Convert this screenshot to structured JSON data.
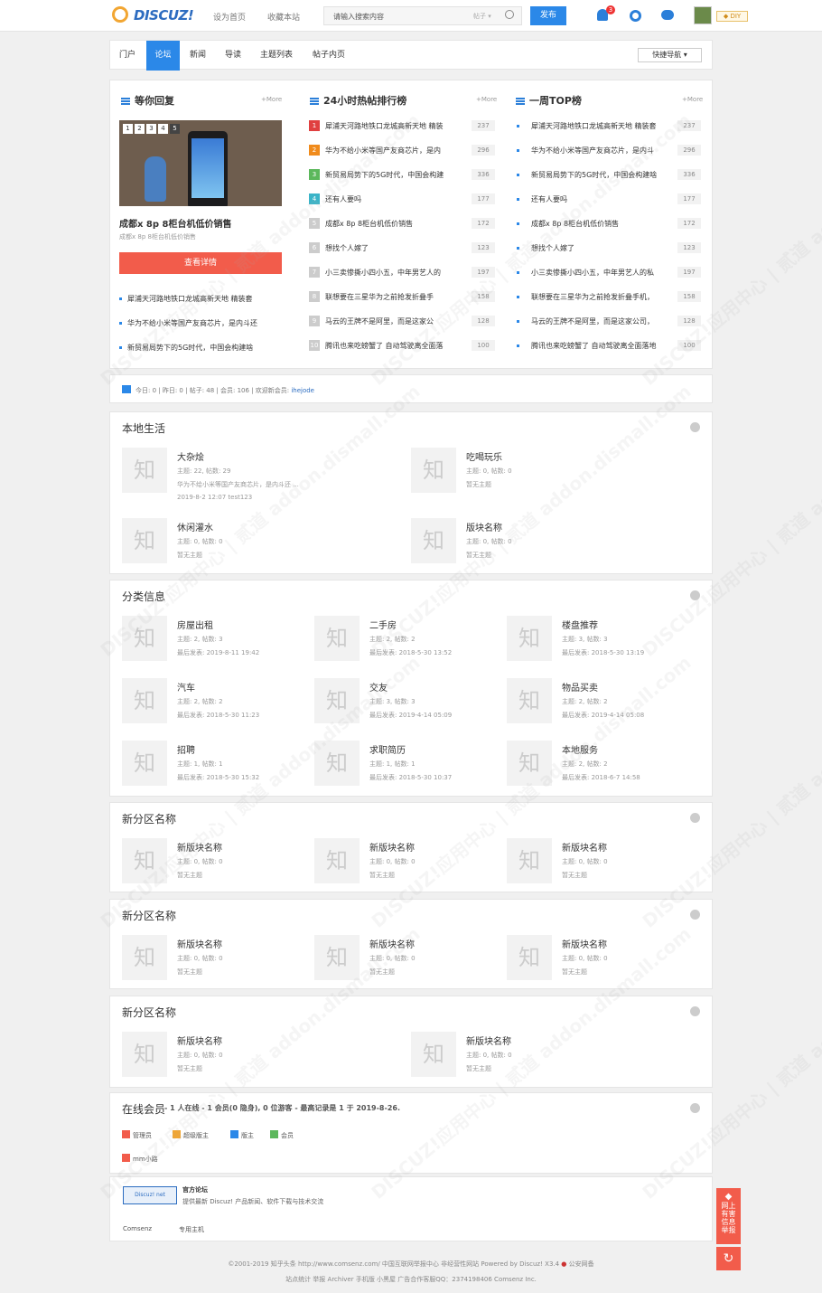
{
  "header": {
    "logo": "DISCUZ!",
    "links": [
      "设为首页",
      "收藏本站"
    ],
    "search_placeholder": "请输入搜索内容",
    "search_type": "帖子 ▾",
    "publish": "发布",
    "notice_count": "3",
    "diy": "DIY"
  },
  "nav": {
    "items": [
      "门户",
      "论坛",
      "新闻",
      "导读",
      "主题列表",
      "帖子内页"
    ],
    "quick": "快捷导航 ▾"
  },
  "col1": {
    "title": "等你回复",
    "more": "+More",
    "photo_nums": [
      "1",
      "2",
      "3",
      "4",
      "5"
    ],
    "photo_title": "成都x 8p 8柜台机低价销售",
    "photo_sub": "成都x 8p 8柜台机低价销售",
    "button": "查看详情",
    "list": [
      "犀浦天河路地铁口龙城高新天地 精装套",
      "华为不给小米等国产友商芯片，是内斗还",
      "新贸易局势下的5G时代，中国会构建啥"
    ]
  },
  "col2": {
    "title": "24小时热帖排行榜",
    "more": "+More",
    "items": [
      {
        "n": "1",
        "t": "犀浦天河路地铁口龙城高新天地 精装",
        "c": "237"
      },
      {
        "n": "2",
        "t": "华为不给小米等国产友商芯片，是内",
        "c": "296"
      },
      {
        "n": "3",
        "t": "新贸易局势下的5G时代，中国会构建",
        "c": "336"
      },
      {
        "n": "4",
        "t": "还有人要吗",
        "c": "177"
      },
      {
        "n": "5",
        "t": "成都x 8p 8柜台机低价销售",
        "c": "172"
      },
      {
        "n": "6",
        "t": "想找个人嫁了",
        "c": "123"
      },
      {
        "n": "7",
        "t": "小三卖惨撕小四小五，中年男艺人的",
        "c": "197"
      },
      {
        "n": "8",
        "t": "联想要在三星华为之前抢发折叠手",
        "c": "158"
      },
      {
        "n": "9",
        "t": "马云的王牌不是阿里，而是这家公",
        "c": "128"
      },
      {
        "n": "10",
        "t": "腾讯也来吃螃蟹了 自动驾驶离全面落",
        "c": "100"
      }
    ]
  },
  "col3": {
    "title": "一周TOP榜",
    "more": "+More",
    "items": [
      {
        "t": "犀浦天河路地铁口龙城高新天地 精装套",
        "c": "237"
      },
      {
        "t": "华为不给小米等国产友商芯片，是内斗",
        "c": "296"
      },
      {
        "t": "新贸易局势下的5G时代，中国会构建啥",
        "c": "336"
      },
      {
        "t": "还有人要吗",
        "c": "177"
      },
      {
        "t": "成都x 8p 8柜台机低价销售",
        "c": "172"
      },
      {
        "t": "想找个人嫁了",
        "c": "123"
      },
      {
        "t": "小三卖惨撕小四小五，中年男艺人的私",
        "c": "197"
      },
      {
        "t": "联想要在三星华为之前抢发折叠手机，",
        "c": "158"
      },
      {
        "t": "马云的王牌不是阿里，而是这家公司，",
        "c": "128"
      },
      {
        "t": "腾讯也来吃螃蟹了 自动驾驶离全面落地",
        "c": "100"
      }
    ]
  },
  "stats": {
    "text": "今日: 0 | 昨日: 0 | 帖子: 48 | 会员: 106 | 欢迎新会员: ",
    "newuser": "ihejode"
  },
  "zones": [
    {
      "title": "本地生活",
      "forums": [
        {
          "name": "大杂烩",
          "l1": "主题: 22, 帖数: 29",
          "l2": "华为不给小米等国产友商芯片，是内斗还 ...",
          "l3": "2019-8-2 12:07 test123"
        },
        {
          "name": "吃喝玩乐",
          "l1": "主题: 0, 帖数: 0",
          "l2": "暂无主题"
        },
        {
          "name": "休闲灌水",
          "l1": "主题: 0, 帖数: 0",
          "l2": "暂无主题"
        },
        {
          "name": "版块名称",
          "l1": "主题: 0, 帖数: 0",
          "l2": "暂无主题"
        }
      ]
    },
    {
      "title": "分类信息",
      "forums": [
        {
          "name": "房屋出租",
          "l1": "主题: 2, 帖数: 3",
          "l2": "最后发表: 2019-8-11 19:42"
        },
        {
          "name": "二手房",
          "l1": "主题: 2, 帖数: 2",
          "l2": "最后发表: 2018-5-30 13:52"
        },
        {
          "name": "楼盘推荐",
          "l1": "主题: 3, 帖数: 3",
          "l2": "最后发表: 2018-5-30 13:19"
        },
        {
          "name": "汽车",
          "l1": "主题: 2, 帖数: 2",
          "l2": "最后发表: 2018-5-30 11:23"
        },
        {
          "name": "交友",
          "l1": "主题: 3, 帖数: 3",
          "l2": "最后发表: 2019-4-14 05:09"
        },
        {
          "name": "物品买卖",
          "l1": "主题: 2, 帖数: 2",
          "l2": "最后发表: 2019-4-14 05:08"
        },
        {
          "name": "招聘",
          "l1": "主题: 1, 帖数: 1",
          "l2": "最后发表: 2018-5-30 15:32"
        },
        {
          "name": "求职简历",
          "l1": "主题: 1, 帖数: 1",
          "l2": "最后发表: 2018-5-30 10:37"
        },
        {
          "name": "本地服务",
          "l1": "主题: 2, 帖数: 2",
          "l2": "最后发表: 2018-6-7 14:58"
        }
      ]
    },
    {
      "title": "新分区名称",
      "forums": [
        {
          "name": "新版块名称",
          "l1": "主题: 0, 帖数: 0",
          "l2": "暂无主题"
        },
        {
          "name": "新版块名称",
          "l1": "主题: 0, 帖数: 0",
          "l2": "暂无主题"
        },
        {
          "name": "新版块名称",
          "l1": "主题: 0, 帖数: 0",
          "l2": "暂无主题"
        }
      ]
    },
    {
      "title": "新分区名称",
      "forums": [
        {
          "name": "新版块名称",
          "l1": "主题: 0, 帖数: 0",
          "l2": "暂无主题"
        },
        {
          "name": "新版块名称",
          "l1": "主题: 0, 帖数: 0",
          "l2": "暂无主题"
        },
        {
          "name": "新版块名称",
          "l1": "主题: 0, 帖数: 0",
          "l2": "暂无主题"
        }
      ]
    },
    {
      "title": "新分区名称",
      "forums": [
        {
          "name": "新版块名称",
          "l1": "主题: 0, 帖数: 0",
          "l2": "暂无主题"
        },
        {
          "name": "新版块名称",
          "l1": "主题: 0, 帖数: 0",
          "l2": "暂无主题"
        }
      ]
    }
  ],
  "forum_icon_char": "知",
  "online": {
    "title": "在线会员",
    "summary": "- 1 人在线 - 1 会员(0 隐身), 0 位游客 - 最高记录是 1 于 2019-8-26.",
    "legend": [
      "管理员",
      "超级版主",
      "版主",
      "会员"
    ],
    "legend_colors": [
      "#f25c4b",
      "#f2a632",
      "#2b88e8",
      "#5cb85c"
    ],
    "member": "mm小路"
  },
  "links": {
    "logo": "Discuz! net",
    "name": "官方论坛",
    "desc": "提供最新 Discuz! 产品新闻、软件下载与技术交流",
    "items": [
      "Comsenz",
      "专用主机"
    ]
  },
  "footer": {
    "line1": "©2001-2019 知乎头条 http://www.comsenz.com/  中国互联网举报中心  非经营性网站  Powered by Discuz! X3.4  ",
    "police": "公安网备",
    "line2": "站点统计  举报  Archiver  手机版  小黑屋  广告合作客服QQ：2374198406  Comsenz Inc."
  },
  "side": {
    "report": "网上有害信息举报",
    "top": "↻"
  },
  "watermark": "DISCUZ!应用中心 | 贰道 addon.dismall.com"
}
